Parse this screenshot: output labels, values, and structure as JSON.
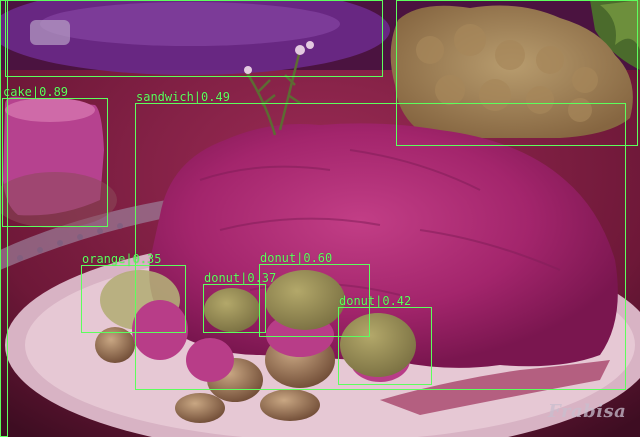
{
  "colors": {
    "box": "#5dff5d",
    "mask_purple": "#8a1f8a",
    "mask_brown": "#9a7448"
  },
  "detections": [
    {
      "label": "cake",
      "score": "0.89",
      "text": "cake|0.89"
    },
    {
      "label": "sandwich",
      "score": "0.49",
      "text": "sandwich|0.49"
    },
    {
      "label": "orange",
      "score": "0.35",
      "text": "orange|0.35"
    },
    {
      "label": "donut",
      "score": "0.37",
      "text": "donut|0.37"
    },
    {
      "label": "donut",
      "score": "0.60",
      "text": "donut|0.60"
    },
    {
      "label": "donut",
      "score": "0.42",
      "text": "donut|0.42"
    }
  ],
  "watermark": "Frabisa"
}
